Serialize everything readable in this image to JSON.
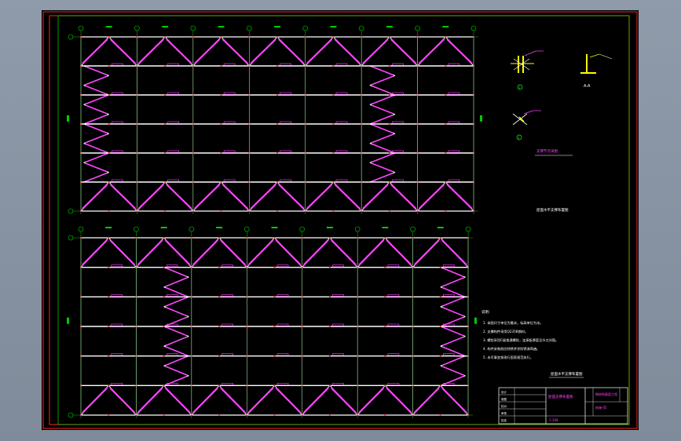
{
  "drawing": {
    "title": "Steel roof bracing plan — CAD drawing",
    "colors": {
      "background": "#000000",
      "frame": "#ff2222",
      "inner_frame": "#00ff00",
      "grid": "#00cc00",
      "member": "#ffffff",
      "brace": "#ff44ff",
      "node": "#ff3030",
      "detail": "#ffff00",
      "note_text": "#ffffff"
    },
    "plan_top_caption": "屋面水平支撑布置图",
    "plan_bottom_caption": "屋面水平支撑布置图",
    "detail_caption": "支撑节点详图",
    "detail_labels": [
      "1",
      "A-A",
      "2"
    ],
    "notes_heading": "说明：",
    "notes": [
      "1. 本图尺寸单位为毫米，标高单位为米。",
      "2. 支撑构件采用Q235B钢材。",
      "3. 螺栓采用C级普通螺栓，连接板厚度见节点详图。",
      "4. 构件安装前应除锈并涂防锈漆两遍。",
      "5. 未尽事宜按现行国家规范执行。"
    ],
    "title_block": {
      "project": "钢结构屋面工程",
      "drawing_name": "屋面支撑布置图",
      "drawing_no": "结施-05",
      "scale": "1:100",
      "rows": [
        "设计",
        "制图",
        "校对",
        "审核",
        "批准"
      ]
    }
  }
}
